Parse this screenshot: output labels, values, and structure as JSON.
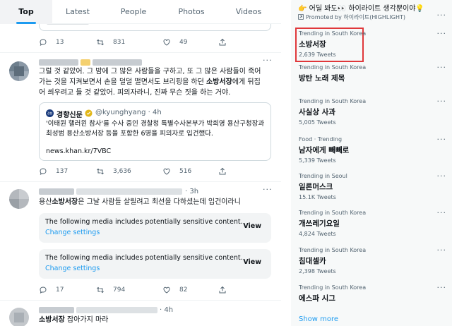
{
  "tabs": [
    {
      "label": "Top"
    },
    {
      "label": "Latest"
    },
    {
      "label": "People"
    },
    {
      "label": "Photos"
    },
    {
      "label": "Videos"
    }
  ],
  "tweets": {
    "first": {
      "reply_count": "13",
      "retweet_count": "831",
      "like_count": "49"
    },
    "second": {
      "text_line1": "그럴 것 같았어. 그 밤에 그 많은 사람들을 구하고, 또 그 많은 사람들이 죽어",
      "text_line2": "가는 것을 지켜보면서 손을 덜덜 떨면서도 브리핑을 하던 ",
      "text_highlight": "소방서장",
      "text_line2_end": "에게 뒤집",
      "text_line3": "어 씌우려고 들 것 같았어. 피의자라니, 진짜 무슨 짓을 하는 거야.",
      "quote": {
        "avatar_text": "경향",
        "name": "경향신문",
        "handle_time": "@kyunghyang · 4h",
        "text": "'이태원 핼러윈 참사'를 수사 중인 경찰청 특별수사본부가 박희영 용산구청장과 최성범 용산소방서장 등을 포함한 6명을 피의자로 입건했다.",
        "link": "news.khan.kr/7VBC"
      },
      "reply_count": "137",
      "retweet_count": "3,636",
      "like_count": "516"
    },
    "third": {
      "time": "3h",
      "text_prefix": "용산",
      "text_highlight": "소방서장",
      "text_rest": "은 그날 사람들 살릴려고 최선을 다하셨는데 입건이라니",
      "media_warning": "The following media includes potentially sensitive content.",
      "media_change": "Change settings",
      "media_view": "View",
      "reply_count": "17",
      "retweet_count": "794",
      "like_count": "82"
    },
    "fourth": {
      "time": "4h",
      "text_highlight": "소방서장",
      "text_rest": " 잡아가지 마라"
    }
  },
  "sidebar": {
    "promo_title": "👉 어딜 봐도👀 하이라이트 생각뿐이야💡",
    "promo_by": "Promoted by 하이라이트(HIGHLIGHT)",
    "trends": [
      {
        "context": "Trending in South Korea",
        "name": "소방서장",
        "count": "2,639 Tweets"
      },
      {
        "context": "Trending in South Korea",
        "name": "방탄 노래 제목",
        "count": ""
      },
      {
        "context": "Trending in South Korea",
        "name": "사실상 사과",
        "count": "5,005 Tweets"
      },
      {
        "context": "Food · Trending",
        "name": "남자에게 빼빼로",
        "count": "5,339 Tweets"
      },
      {
        "context": "Trending in Seoul",
        "name": "일론머스크",
        "count": "15.1K Tweets"
      },
      {
        "context": "Trending in South Korea",
        "name": "개쓰레기요일",
        "count": "4,824 Tweets"
      },
      {
        "context": "Trending in South Korea",
        "name": "침대셀카",
        "count": "2,398 Tweets"
      },
      {
        "context": "Trending in South Korea",
        "name": "에스파 시그",
        "count": ""
      }
    ],
    "show_more": "Show more"
  },
  "colors": {
    "accent": "#1d9bf0",
    "highlight_box": "#e0383b",
    "panel_bg": "#f7f9f9"
  }
}
